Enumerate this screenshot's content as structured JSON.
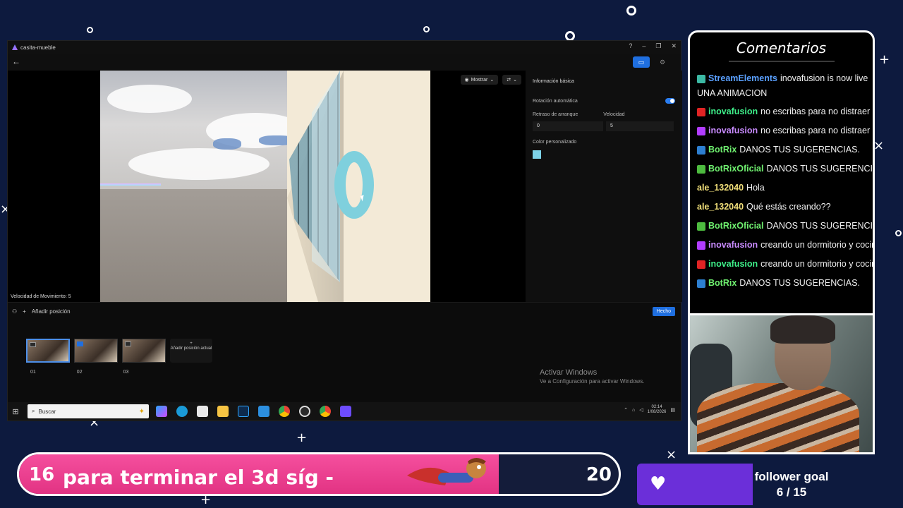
{
  "app": {
    "title": "casita-mueble",
    "window_controls": [
      "?",
      "–",
      "❐",
      "✕"
    ],
    "viewport": {
      "show_button": "Mostrar",
      "speed_label": "Velocidad de Movimiento: 5"
    },
    "panel": {
      "section_title": "Información básica",
      "auto_rotation_label": "Rotación automática",
      "auto_rotation_on": true,
      "start_delay_label": "Retraso de arranque",
      "speed_label": "Velocidad",
      "start_delay_value": "0",
      "speed_value": "5",
      "custom_color_label": "Color personalizado",
      "custom_color": "#7ed3e8"
    },
    "add_position_label": "Añadir posición",
    "done_button": "Hecho",
    "thumbnails": [
      {
        "label": "01",
        "selected": true
      },
      {
        "label": "02",
        "selected": false
      },
      {
        "label": "03",
        "selected": false
      }
    ],
    "add_current_position": "Añadir posición actual",
    "activate_windows": {
      "title": "Activar Windows",
      "subtitle": "Ve a Configuración para activar Windows."
    },
    "taskbar": {
      "search_placeholder": "Buscar",
      "time": "02:14",
      "date": "1/08/2026"
    }
  },
  "comments": {
    "title": "Comentarios",
    "messages": [
      {
        "user": "StreamElements",
        "text": "inovafusion is now live",
        "user_color": "#5aa0ff",
        "badge": "#3cb9a4"
      },
      {
        "user": "",
        "text": "UNA ANIMACION",
        "user_color": "#ffffff",
        "badge": ""
      },
      {
        "user": "inovafusion",
        "text": "no escribas para no distraer",
        "user_color": "#3ef08a",
        "badge": "#e02424"
      },
      {
        "user": "inovafusion",
        "text": "no escribas para no distraer",
        "user_color": "#c98bff",
        "badge": "#b13cff"
      },
      {
        "user": "BotRix",
        "text": "DANOS TUS SUGERENCIAS.",
        "user_color": "#6ff06f",
        "badge": "#2d7fd1"
      },
      {
        "user": "BotRixOficial",
        "text": "DANOS TUS SUGERENCIAS.",
        "user_color": "#6ff06f",
        "badge": "#4dbb3f"
      },
      {
        "user": "ale_132040",
        "text": "Hola",
        "user_color": "#f2e07a",
        "badge": ""
      },
      {
        "user": "ale_132040",
        "text": "Qué estás creando??",
        "user_color": "#f2e07a",
        "badge": ""
      },
      {
        "user": "BotRixOficial",
        "text": "DANOS TUS SUGERENCIAS.",
        "user_color": "#6ff06f",
        "badge": "#4dbb3f"
      },
      {
        "user": "inovafusion",
        "text": "creando un dormitorio y cocina",
        "user_color": "#c98bff",
        "badge": "#b13cff"
      },
      {
        "user": "inovafusion",
        "text": "creando un dormitorio y cocina",
        "user_color": "#3ef08a",
        "badge": "#e02424"
      },
      {
        "user": "BotRix",
        "text": "DANOS TUS SUGERENCIAS.",
        "user_color": "#6ff06f",
        "badge": "#2d7fd1"
      }
    ]
  },
  "goal_bar": {
    "start": "16",
    "text": "para terminar el 3d       síg  -",
    "end": "20",
    "progress": 0.8
  },
  "follower_goal": {
    "label": "follower goal",
    "count": "6 / 15"
  }
}
